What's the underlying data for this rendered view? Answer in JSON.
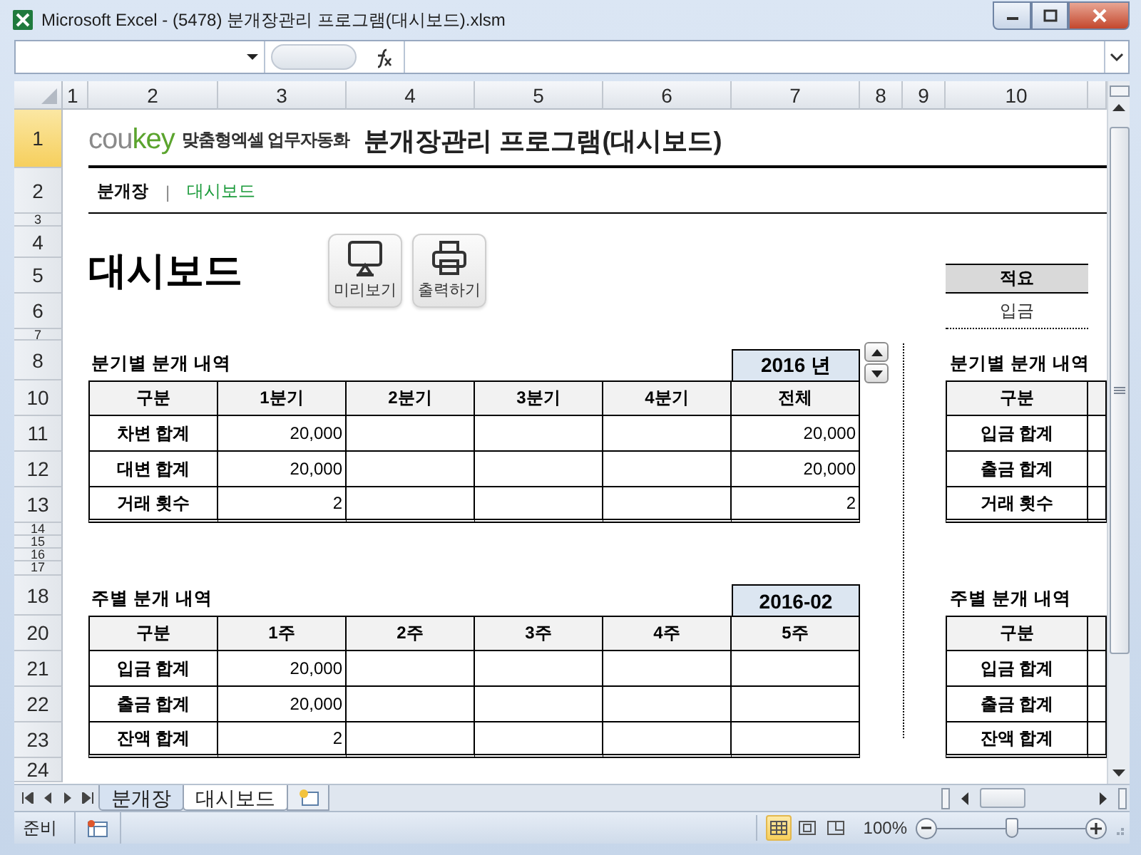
{
  "window": {
    "title": "Microsoft Excel - (5478) 분개장관리 프로그램(대시보드).xlsm"
  },
  "columns": [
    "1",
    "2",
    "3",
    "4",
    "5",
    "6",
    "7",
    "8",
    "9",
    "10"
  ],
  "rows": [
    {
      "label": "1",
      "selected": true
    },
    {
      "label": "2",
      "selected": false
    },
    {
      "label": "3",
      "selected": false
    },
    {
      "label": "4",
      "selected": false
    },
    {
      "label": "5",
      "selected": false
    },
    {
      "label": "6",
      "selected": false
    },
    {
      "label": "7",
      "selected": false
    },
    {
      "label": "8",
      "selected": false
    },
    {
      "label": "10",
      "selected": false
    },
    {
      "label": "11",
      "selected": false
    },
    {
      "label": "12",
      "selected": false
    },
    {
      "label": "13",
      "selected": false
    },
    {
      "label": "14",
      "selected": false
    },
    {
      "label": "15",
      "selected": false
    },
    {
      "label": "16",
      "selected": false
    },
    {
      "label": "17",
      "selected": false
    },
    {
      "label": "18",
      "selected": false
    },
    {
      "label": "20",
      "selected": false
    },
    {
      "label": "21",
      "selected": false
    },
    {
      "label": "22",
      "selected": false
    },
    {
      "label": "23",
      "selected": false
    },
    {
      "label": "24",
      "selected": false
    }
  ],
  "banner": {
    "brand": {
      "first": "cou",
      "second": "key"
    },
    "tagline": "맞춤형엑셀 업무자동화",
    "title": "분개장관리 프로그램(대시보드)"
  },
  "nav": {
    "items": [
      {
        "label": "분개장",
        "selected": false
      },
      {
        "label": "대시보드",
        "selected": true
      }
    ],
    "separator": "|"
  },
  "heading": "대시보드",
  "buttons": [
    {
      "kind": "monitor",
      "label": "미리보기"
    },
    {
      "kind": "printer",
      "label": "출력하기"
    }
  ],
  "memo": {
    "header": "적요",
    "value": "입금"
  },
  "quarterly": {
    "title": "분기별 분개 내역",
    "period": "2016 년",
    "columns": [
      "구분",
      "1분기",
      "2분기",
      "3분기",
      "4분기",
      "전체"
    ],
    "rows": [
      {
        "label": "차변 합계",
        "cells": [
          "20,000",
          null,
          null,
          null,
          "20,000"
        ]
      },
      {
        "label": "대변 합계",
        "cells": [
          "20,000",
          null,
          null,
          null,
          "20,000"
        ]
      },
      {
        "label": "거래 횟수",
        "cells": [
          "2",
          null,
          null,
          null,
          "2"
        ]
      }
    ]
  },
  "side_quarterly": {
    "title": "분기별 분개 내역",
    "header": "구분",
    "rows": [
      "입금 합계",
      "출금 합계",
      "거래 횟수"
    ]
  },
  "weekly": {
    "title": "주별 분개 내역",
    "period": "2016-02",
    "columns": [
      "구분",
      "1주",
      "2주",
      "3주",
      "4주",
      "5주"
    ],
    "rows": [
      {
        "label": "입금 합계",
        "cells": [
          "20,000",
          null,
          null,
          null,
          null
        ]
      },
      {
        "label": "출금 합계",
        "cells": [
          "20,000",
          null,
          null,
          null,
          null
        ]
      },
      {
        "label": "잔액 합계",
        "cells": [
          "2",
          null,
          null,
          null,
          null
        ]
      }
    ]
  },
  "side_weekly": {
    "title": "주별 분개 내역",
    "header": "구분",
    "rows": [
      "입금 합계",
      "출금 합계",
      "잔액 합계"
    ]
  },
  "sheet_tabs": [
    {
      "label": "분개장",
      "selected": false
    },
    {
      "label": "대시보드",
      "selected": true
    }
  ],
  "status": {
    "mode": "준비",
    "views": [
      {
        "kind": "normal",
        "selected": true
      },
      {
        "kind": "layout",
        "selected": false
      },
      {
        "kind": "pagebreak",
        "selected": false
      }
    ],
    "zoom": "100%",
    "zoom_slider": {
      "level": 0.5
    }
  }
}
